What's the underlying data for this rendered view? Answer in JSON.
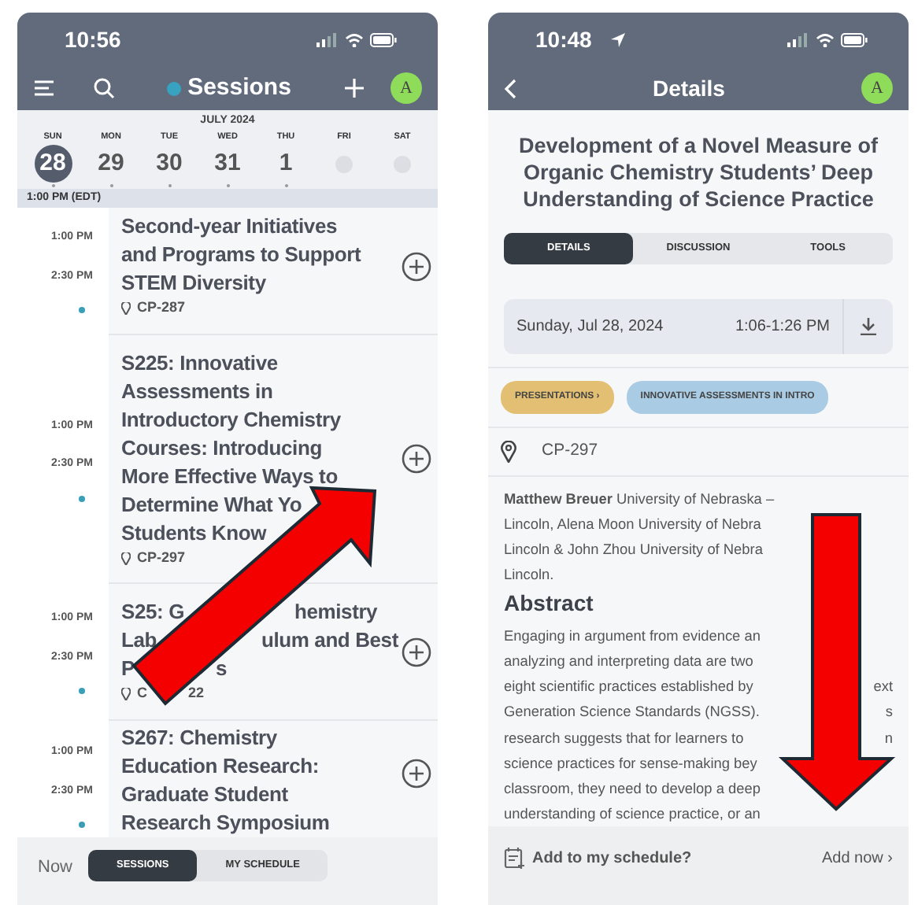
{
  "sessions_screen": {
    "status_bar": {
      "time": "10:56"
    },
    "title": "Sessions",
    "avatar": "A",
    "calendar": {
      "month": "JULY 2024",
      "days": [
        {
          "weekday": "SUN",
          "number": "28",
          "selected": true,
          "has_sessions": true
        },
        {
          "weekday": "MON",
          "number": "29",
          "selected": false,
          "has_sessions": true
        },
        {
          "weekday": "TUE",
          "number": "30",
          "selected": false,
          "has_sessions": true
        },
        {
          "weekday": "WED",
          "number": "31",
          "selected": false,
          "has_sessions": true
        },
        {
          "weekday": "THU",
          "number": "1",
          "selected": false,
          "has_sessions": true
        },
        {
          "weekday": "FRI",
          "selected": false,
          "has_sessions": false
        },
        {
          "weekday": "SAT",
          "selected": false,
          "has_sessions": false
        }
      ]
    },
    "time_header": "1:00 PM (EDT)",
    "sessions": [
      {
        "start": "1:00 PM",
        "end": "2:30 PM",
        "title_lines": [
          "Second-year Initiatives",
          "and Programs to Support",
          "STEM Diversity"
        ],
        "location": [
          "CP-287"
        ]
      },
      {
        "start": "1:00 PM",
        "end": "2:30 PM",
        "title_lines": [
          "S225: Innovative",
          "Assessments in",
          "Introductory Chemistry",
          "Courses: Introducing",
          "More Effective Ways to",
          "Determine What Yo",
          "Students Know"
        ],
        "location": [
          "CP-297"
        ]
      },
      {
        "start": "1:00 PM",
        "end": "2:30 PM",
        "title_lines": [
          [
            "S25: G",
            "hemistry"
          ],
          [
            "Lab",
            "ulum and Best"
          ],
          [
            "P",
            "s"
          ]
        ],
        "location": [
          "C",
          "22"
        ]
      },
      {
        "start": "1:00 PM",
        "end": "2:30 PM",
        "title_lines": [
          "S267: Chemistry",
          "Education Research:",
          "Graduate Student",
          "Research Symposium"
        ]
      }
    ],
    "bottom_bar": {
      "now": "Now",
      "tabs": [
        {
          "label": "SESSIONS",
          "selected": true
        },
        {
          "label": "MY SCHEDULE",
          "selected": false
        }
      ]
    }
  },
  "details_screen": {
    "status_bar": {
      "time": "10:48"
    },
    "title": "Details",
    "avatar": "A",
    "heading": "Development of a Novel Measure of Organic Chemistry Students’ Deep Understanding of Science Practice",
    "tabs": [
      {
        "label": "DETAILS",
        "selected": true
      },
      {
        "label": "DISCUSSION",
        "selected": false
      },
      {
        "label": "TOOLS",
        "selected": false
      }
    ],
    "date": "Sunday, Jul 28, 2024",
    "time": "1:06-1:26 PM",
    "tags": [
      {
        "label": "PRESENTATIONS ›",
        "color": "#e2bf72"
      },
      {
        "label": "INNOVATIVE ASSESSMENTS IN INTRO",
        "color": "#a9cbe3"
      }
    ],
    "location": "CP-297",
    "author_lines": [
      "**Matthew Breuer** University of Nebraska –",
      "Lincoln, Alena Moon University of Nebra",
      "Lincoln & John Zhou University of Nebra",
      "Lincoln."
    ],
    "abstract_heading": "Abstract",
    "abstract_lines": [
      "Engaging in argument from evidence an",
      "analyzing and interpreting data are two",
      [
        "eight scientific practices established by",
        "ext"
      ],
      [
        "Generation Science Standards (NGSS).",
        "s"
      ],
      [
        "research suggests that for learners to",
        "n"
      ],
      "science practices for sense-making bey",
      "classroom, they need to develop a deep",
      "understanding of science practice, or an"
    ],
    "bottom_bar": {
      "prompt": "Add to my schedule?",
      "action": "Add now ›"
    }
  }
}
